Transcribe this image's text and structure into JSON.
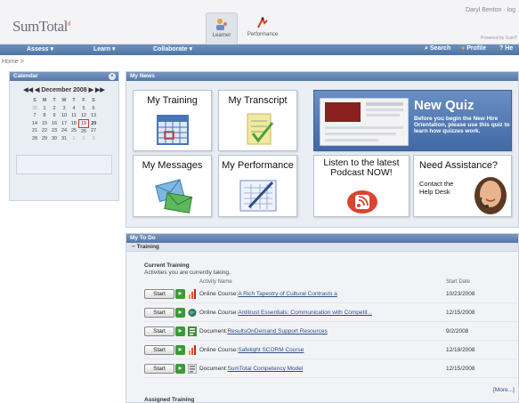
{
  "header": {
    "logo": "SumTotal",
    "user_name": "Daryl Benton · log",
    "powered_by": "Powered by SumT",
    "modes": [
      {
        "label": "Learner"
      },
      {
        "label": "Performance"
      }
    ]
  },
  "nav": {
    "items": [
      "Assess",
      "Learn",
      "Collaborate"
    ],
    "right": [
      "Search",
      "Profile",
      "He"
    ]
  },
  "breadcrumb": "Home >",
  "calendar": {
    "title": "Calendar",
    "month": "December 2008",
    "prev_year": "◀◀",
    "prev_month": "◀",
    "next_month": "▶",
    "next_year": "▶▶",
    "days": [
      "S",
      "M",
      "T",
      "W",
      "T",
      "F",
      "S"
    ],
    "weeks": [
      [
        "30",
        "1",
        "2",
        "3",
        "4",
        "5",
        "6"
      ],
      [
        "7",
        "8",
        "9",
        "10",
        "11",
        "12",
        "13"
      ],
      [
        "14",
        "15",
        "16",
        "17",
        "18",
        "19",
        "20"
      ],
      [
        "21",
        "22",
        "23",
        "24",
        "25",
        "26",
        "27"
      ],
      [
        "28",
        "29",
        "30",
        "31",
        "1",
        "2",
        "3"
      ]
    ],
    "today": "19"
  },
  "news": {
    "title": "My News",
    "tiles": {
      "training": "My Training",
      "transcript": "My Transcript",
      "messages": "My Messages",
      "performance": "My Performance",
      "podcast": "Listen to the latest Podcast NOW!",
      "assistance": "Need Assistance?",
      "assistance_sub": "Contact the Help Desk"
    },
    "quiz": {
      "title": "New Quiz",
      "text": "Before you begin the New Hire Orientation, please use this quiz to learn how quizzes work."
    }
  },
  "todo": {
    "title": "My To Do",
    "section": "Training",
    "current_title": "Current Training",
    "current_sub": "Activities you are currently taking.",
    "col_activity": "Activity Name",
    "col_date": "Start Date",
    "start_label": "Start",
    "rows": [
      {
        "type": "Online Course:",
        "name": "A Rich Tapestry of Cultural Contrasts a",
        "date": "10/23/2008"
      },
      {
        "type": "Online Course:",
        "name": "Antitrust Essentials: Communication with Competit...",
        "date": "12/15/2008"
      },
      {
        "type": "Document:",
        "name": "ResultsOnDemand Support Resources",
        "date": "9/2/2008"
      },
      {
        "type": "Online Course:",
        "name": "Safelight SCORM Course",
        "date": "12/18/2008"
      },
      {
        "type": "Document:",
        "name": "SumTotal Competency Model",
        "date": "12/15/2008"
      }
    ],
    "more": "[More...]",
    "assigned": "Assigned Training"
  }
}
